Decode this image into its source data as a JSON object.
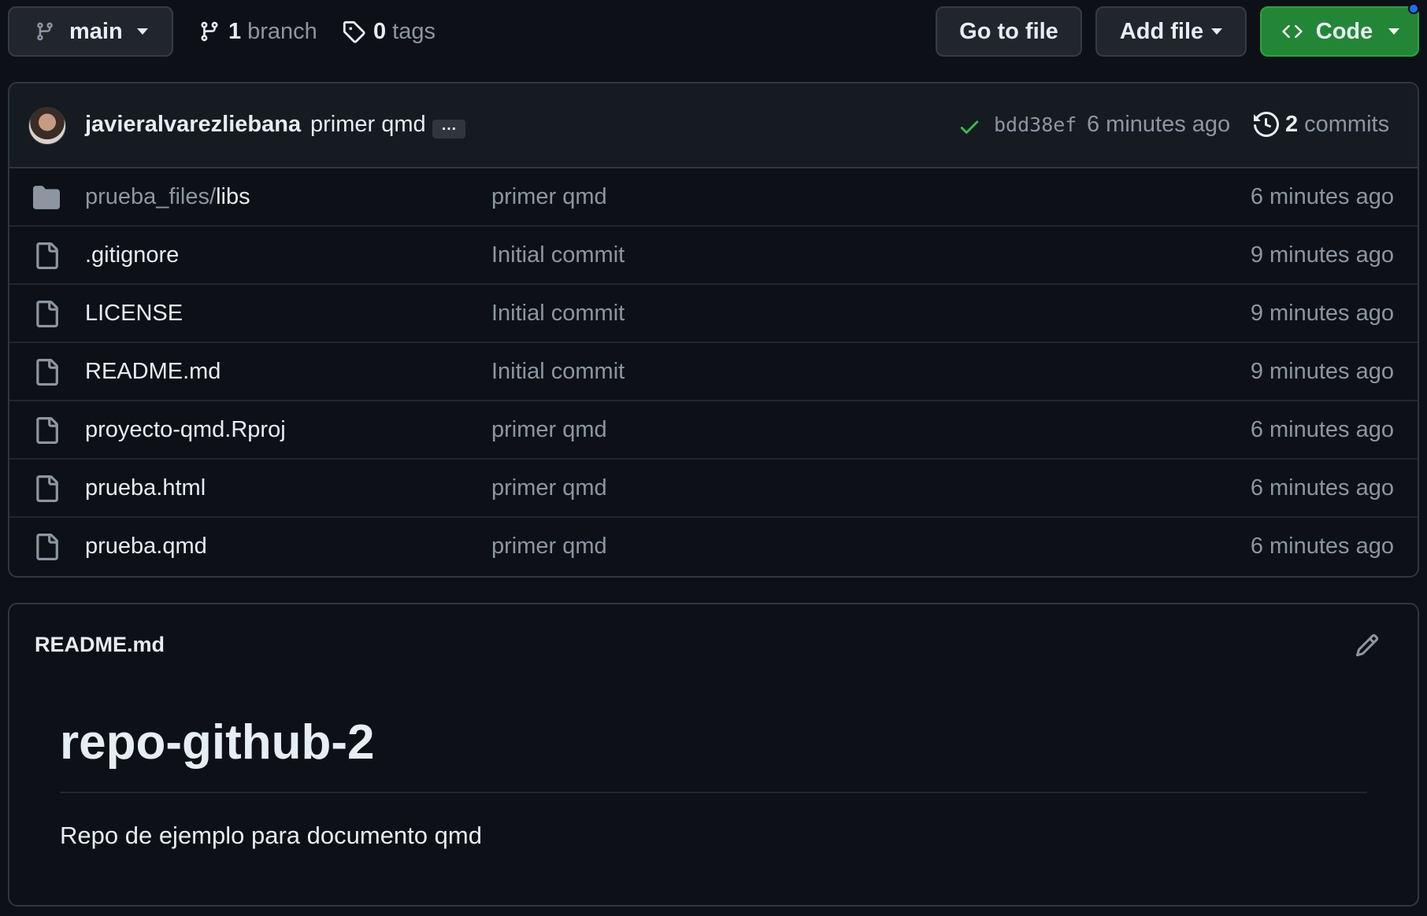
{
  "toolbar": {
    "branch_button_label": "main",
    "branches_count": "1",
    "branches_label": "branch",
    "tags_count": "0",
    "tags_label": "tags",
    "go_to_file_label": "Go to file",
    "add_file_label": "Add file",
    "code_label": "Code"
  },
  "commit": {
    "author": "javieralvarezliebana",
    "message": "primer qmd",
    "ellipsis": "…",
    "sha": "bdd38ef",
    "time": "6 minutes ago",
    "commits_count": "2",
    "commits_label": "commits"
  },
  "files": [
    {
      "type": "folder",
      "name_prefix": "prueba_files/",
      "name": "libs",
      "message": "primer qmd",
      "time": "6 minutes ago"
    },
    {
      "type": "file",
      "name_prefix": "",
      "name": ".gitignore",
      "message": "Initial commit",
      "time": "9 minutes ago"
    },
    {
      "type": "file",
      "name_prefix": "",
      "name": "LICENSE",
      "message": "Initial commit",
      "time": "9 minutes ago"
    },
    {
      "type": "file",
      "name_prefix": "",
      "name": "README.md",
      "message": "Initial commit",
      "time": "9 minutes ago"
    },
    {
      "type": "file",
      "name_prefix": "",
      "name": "proyecto-qmd.Rproj",
      "message": "primer qmd",
      "time": "6 minutes ago"
    },
    {
      "type": "file",
      "name_prefix": "",
      "name": "prueba.html",
      "message": "primer qmd",
      "time": "6 minutes ago"
    },
    {
      "type": "file",
      "name_prefix": "",
      "name": "prueba.qmd",
      "message": "primer qmd",
      "time": "6 minutes ago"
    }
  ],
  "readme": {
    "file_title": "README.md",
    "heading": "repo-github-2",
    "paragraph": "Repo de ejemplo para documento qmd"
  },
  "colors": {
    "background": "#0d1117",
    "code_button": "#238636",
    "check_icon": "#3fb950",
    "notification_dot": "#1f6feb"
  }
}
